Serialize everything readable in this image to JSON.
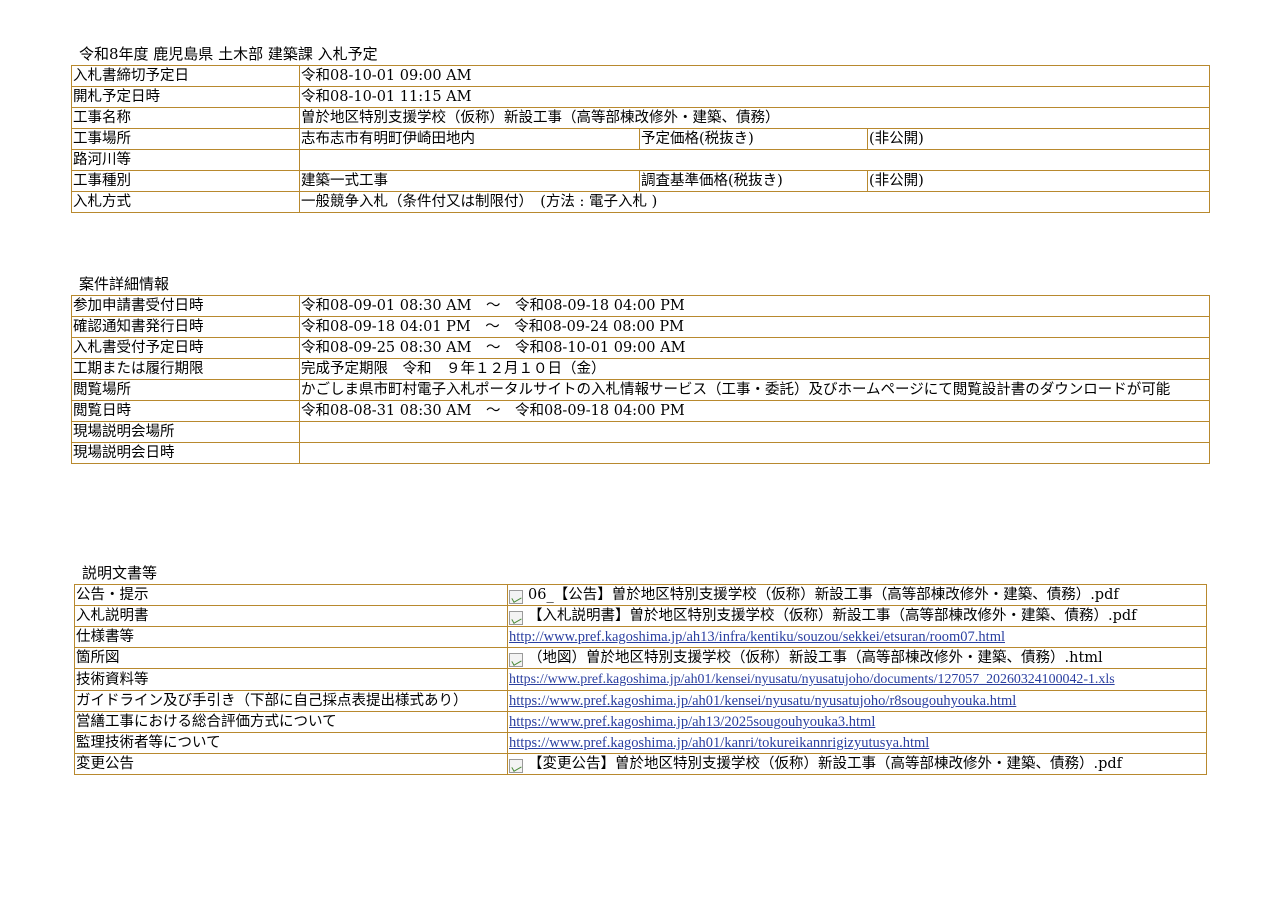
{
  "bid": {
    "title": "令和8年度  鹿児島県  土木部  建築課  入札予定",
    "rows": {
      "deadline_label": "入札書締切予定日",
      "deadline_value": "令和08-10-01 09:00 AM",
      "opening_label": "開札予定日時",
      "opening_value": "令和08-10-01 11:15 AM",
      "name_label": "工事名称",
      "name_value": "曽於地区特別支援学校（仮称）新設工事（高等部棟改修外・建築、債務）",
      "location_label": "工事場所",
      "location_value": "志布志市有明町伊崎田地内",
      "estimated_price_label": "予定価格(税抜き)",
      "estimated_price_value": "(非公開)",
      "road_river_label": "路河川等",
      "road_river_value": "",
      "work_type_label": "工事種別",
      "work_type_value": "建築一式工事",
      "survey_price_label": "調査基準価格(税抜き)",
      "survey_price_value": "(非公開)",
      "method_label": "入札方式",
      "method_value": "一般競争入札（条件付又は制限付）　(方法 : 電子入札 )"
    }
  },
  "detail": {
    "title": "案件詳細情報",
    "rows": [
      {
        "label": "参加申請書受付日時",
        "value": "令和08-09-01 08:30 AM　～　令和08-09-18 04:00 PM"
      },
      {
        "label": "確認通知書発行日時",
        "value": "令和08-09-18 04:01 PM　～　令和08-09-24 08:00 PM"
      },
      {
        "label": "入札書受付予定日時",
        "value": "令和08-09-25 08:30 AM　～　令和08-10-01 09:00 AM"
      },
      {
        "label": "工期または履行期限",
        "value": "完成予定期限　令和　９年１２月１０日（金）"
      },
      {
        "label": "閲覧場所",
        "value": "かごしま県市町村電子入札ポータルサイトの入札情報サービス（工事・委託）及びホームページにて閲覧設計書のダウンロードが可能"
      },
      {
        "label": "閲覧日時",
        "value": "令和08-08-31 08:30 AM　～　令和08-09-18 04:00 PM"
      },
      {
        "label": "現場説明会場所",
        "value": ""
      },
      {
        "label": "現場説明会日時",
        "value": ""
      }
    ]
  },
  "docs": {
    "title": "説明文書等",
    "rows": [
      {
        "label": "公告・提示",
        "type": "file",
        "value": "06_【公告】曽於地区特別支援学校（仮称）新設工事（高等部棟改修外・建築、債務）.pdf"
      },
      {
        "label": "入札説明書",
        "type": "file",
        "value": "【入札説明書】曽於地区特別支援学校（仮称）新設工事（高等部棟改修外・建築、債務）.pdf"
      },
      {
        "label": "仕様書等",
        "type": "link",
        "value": "http://www.pref.kagoshima.jp/ah13/infra/kentiku/souzou/sekkei/etsuran/room07.html"
      },
      {
        "label": "箇所図",
        "type": "file",
        "value": "（地図）曽於地区特別支援学校（仮称）新設工事（高等部棟改修外・建築、債務）.html"
      },
      {
        "label": "技術資料等",
        "type": "link",
        "value": "https://www.pref.kagoshima.jp/ah01/kensei/nyusatu/nyusatujoho/documents/127057_20260324100042-1.xls"
      },
      {
        "label": "ガイドライン及び手引き（下部に自己採点表提出様式あり）",
        "type": "link",
        "value": "https://www.pref.kagoshima.jp/ah01/kensei/nyusatu/nyusatujoho/r8sougouhyouka.html"
      },
      {
        "label": "営繕工事における総合評価方式について",
        "type": "link",
        "value": "https://www.pref.kagoshima.jp/ah13/2025sougouhyouka3.html"
      },
      {
        "label": "監理技術者等について",
        "type": "link",
        "value": "https://www.pref.kagoshima.jp/ah01/kanri/tokureikannrigizyutusya.html"
      },
      {
        "label": "変更公告",
        "type": "file",
        "value": "【変更公告】曽於地区特別支援学校（仮称）新設工事（高等部棟改修外・建築、債務）.pdf"
      }
    ]
  }
}
